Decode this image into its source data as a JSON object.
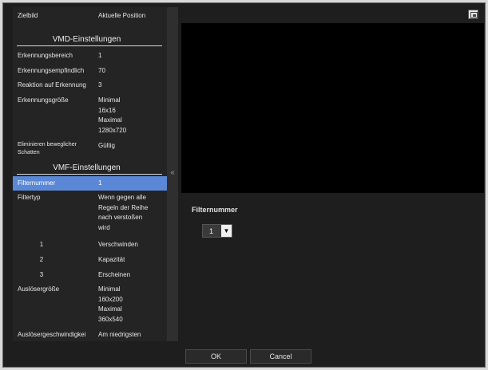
{
  "header": {
    "col1": "Zielbild",
    "col2": "Aktuelle Position"
  },
  "vmd": {
    "title": "VMD-Einstellungen",
    "erkennungsbereich": {
      "label": "Erkennungsbereich",
      "value": "1"
    },
    "empfindlich": {
      "label": "Erkennungsempfindlich",
      "value": "70"
    },
    "reaktion": {
      "label": "Reaktion auf Erkennung",
      "value": "3"
    },
    "groesse": {
      "label": "Erkennungsgröße",
      "lines": [
        "Minimal",
        "16x16",
        "Maximal",
        "1280x720"
      ]
    },
    "schatten": {
      "label_line1": "Eliminieren beweglicher",
      "label_line2": "Schatten",
      "value": "Gültig"
    }
  },
  "vmf": {
    "title": "VMF-Einstellungen",
    "filternummer": {
      "label": "Filternummer",
      "value": "1"
    },
    "filtertyp": {
      "label": "Filtertyp",
      "lines": [
        "Wenn gegen alle",
        "Regeln der Reihe",
        "nach verstoßen",
        "wird"
      ]
    },
    "rules": [
      {
        "num": "1",
        "value": "Verschwinden"
      },
      {
        "num": "2",
        "value": "Kapazität"
      },
      {
        "num": "3",
        "value": "Erscheinen"
      }
    ],
    "ausloesergroesse": {
      "label": "Auslösergröße",
      "lines": [
        "Minimal",
        "160x200",
        "Maximal",
        "360x540"
      ]
    },
    "geschwindigkeit": {
      "label": "Auslösergeschwindigkei",
      "value": "Am niedrigsten"
    }
  },
  "collapse_icon": "double-chevron-left-icon",
  "right": {
    "filter_label": "Filternummer",
    "filter_select_value": "1",
    "dropdown_icon": "triangle-down-icon"
  },
  "buttons": {
    "ok": "OK",
    "cancel": "Cancel"
  }
}
